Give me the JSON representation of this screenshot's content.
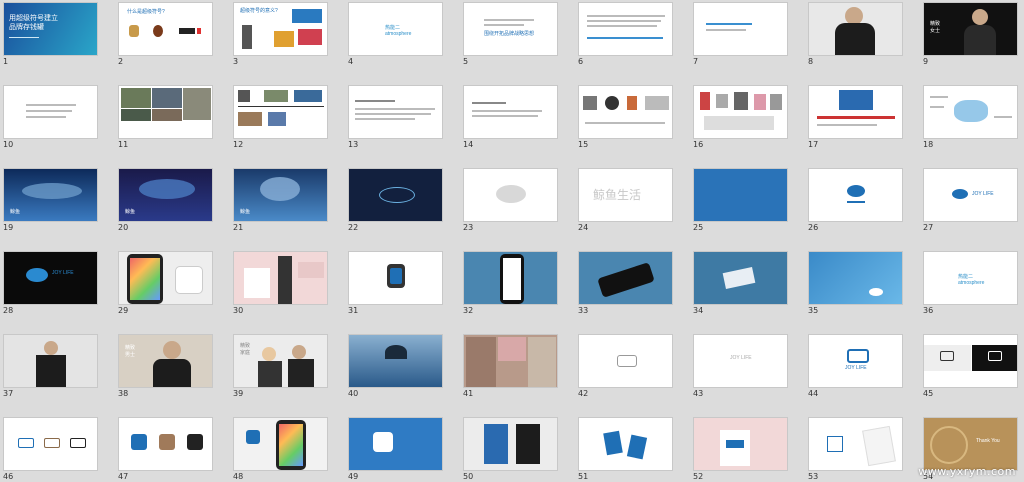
{
  "slides": [
    {
      "n": "1",
      "title": "用超级符号建立",
      "title2": "品牌存钱罐"
    },
    {
      "n": "2",
      "title": "什么是超级符号?"
    },
    {
      "n": "3",
      "title": "超级符号的意义?"
    },
    {
      "n": "4",
      "title": "热能二",
      "title2": "atmosphere"
    },
    {
      "n": "5",
      "title": "围绕开拓品牌战略思想"
    },
    {
      "n": "6",
      "title": ""
    },
    {
      "n": "7",
      "title": ""
    },
    {
      "n": "8",
      "title": ""
    },
    {
      "n": "9",
      "title": "精致",
      "title2": "女士"
    },
    {
      "n": "10",
      "title": ""
    },
    {
      "n": "11",
      "title": ""
    },
    {
      "n": "12",
      "title": ""
    },
    {
      "n": "13",
      "title": ""
    },
    {
      "n": "14",
      "title": ""
    },
    {
      "n": "15",
      "title": ""
    },
    {
      "n": "16",
      "title": ""
    },
    {
      "n": "17",
      "title": ""
    },
    {
      "n": "18",
      "title": ""
    },
    {
      "n": "19",
      "title": "鲸鱼"
    },
    {
      "n": "20",
      "title": "鲸鱼"
    },
    {
      "n": "21",
      "title": "鲸鱼"
    },
    {
      "n": "22",
      "title": ""
    },
    {
      "n": "23",
      "title": ""
    },
    {
      "n": "24",
      "title": "鲸鱼生活"
    },
    {
      "n": "25",
      "title": ""
    },
    {
      "n": "26",
      "title": ""
    },
    {
      "n": "27",
      "title": "JOY LIFE"
    },
    {
      "n": "28",
      "title": "JOY LIFE"
    },
    {
      "n": "29",
      "title": ""
    },
    {
      "n": "30",
      "title": ""
    },
    {
      "n": "31",
      "title": ""
    },
    {
      "n": "32",
      "title": ""
    },
    {
      "n": "33",
      "title": ""
    },
    {
      "n": "34",
      "title": ""
    },
    {
      "n": "35",
      "title": ""
    },
    {
      "n": "36",
      "title": "热能二",
      "title2": "atmosphere"
    },
    {
      "n": "37",
      "title": ""
    },
    {
      "n": "38",
      "title": "精致",
      "title2": "男士"
    },
    {
      "n": "39",
      "title": "精致",
      "title2": "家庭"
    },
    {
      "n": "40",
      "title": ""
    },
    {
      "n": "41",
      "title": ""
    },
    {
      "n": "42",
      "title": ""
    },
    {
      "n": "43",
      "title": "JOY LIFE"
    },
    {
      "n": "44",
      "title": "JOY LIFE"
    },
    {
      "n": "45",
      "title": ""
    },
    {
      "n": "46",
      "title": ""
    },
    {
      "n": "47",
      "title": ""
    },
    {
      "n": "48",
      "title": ""
    },
    {
      "n": "49",
      "title": ""
    },
    {
      "n": "50",
      "title": ""
    },
    {
      "n": "51",
      "title": ""
    },
    {
      "n": "52",
      "title": ""
    },
    {
      "n": "53",
      "title": ""
    },
    {
      "n": "54",
      "title": "Thank You"
    }
  ],
  "watermark": "www.yxrym.com",
  "colors": {
    "brand_blue": "#1f6fb5",
    "navy": "#16213e",
    "grey_bg": "#dcdcdc"
  }
}
